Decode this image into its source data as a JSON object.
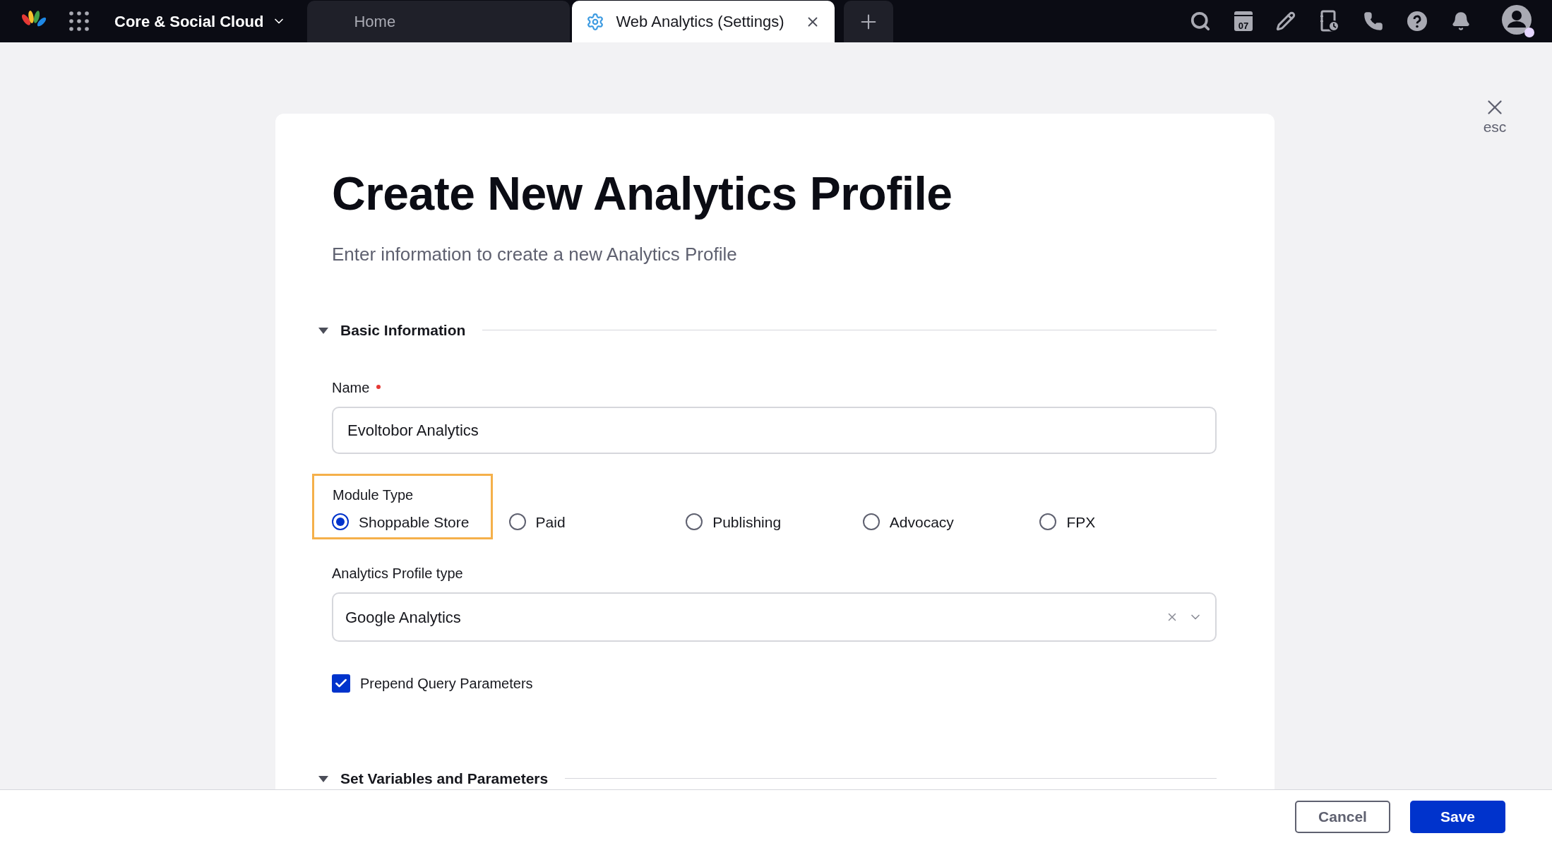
{
  "top_bar": {
    "workspace": "Core & Social Cloud",
    "calendar_day": "07"
  },
  "tabs": [
    {
      "label": "Home",
      "selected": false,
      "kind": "plain"
    },
    {
      "label": "Web Analytics (Settings)",
      "selected": true,
      "kind": "settings"
    }
  ],
  "close": {
    "label": "esc"
  },
  "form": {
    "title": "Create New Analytics Profile",
    "subtitle": "Enter information to create a new Analytics Profile",
    "sections": [
      {
        "title": "Basic Information",
        "expanded": true
      },
      {
        "title": "Set Variables and Parameters",
        "expanded": true
      }
    ],
    "name": {
      "label": "Name",
      "required": true,
      "value": "Evoltobor Analytics"
    },
    "module_type": {
      "label": "Module Type",
      "highlighted": true,
      "options": [
        {
          "label": "Shoppable Store",
          "selected": true
        },
        {
          "label": "Paid",
          "selected": false
        },
        {
          "label": "Publishing",
          "selected": false
        },
        {
          "label": "Advocacy",
          "selected": false
        },
        {
          "label": "FPX",
          "selected": false
        }
      ]
    },
    "profile_type": {
      "label": "Analytics Profile type",
      "value": "Google Analytics"
    },
    "prepend": {
      "label": "Prepend Query Parameters",
      "checked": true
    }
  },
  "footer": {
    "buttons": [
      {
        "label": "Cancel",
        "kind": "secondary"
      },
      {
        "label": "Save",
        "kind": "primary"
      }
    ]
  }
}
